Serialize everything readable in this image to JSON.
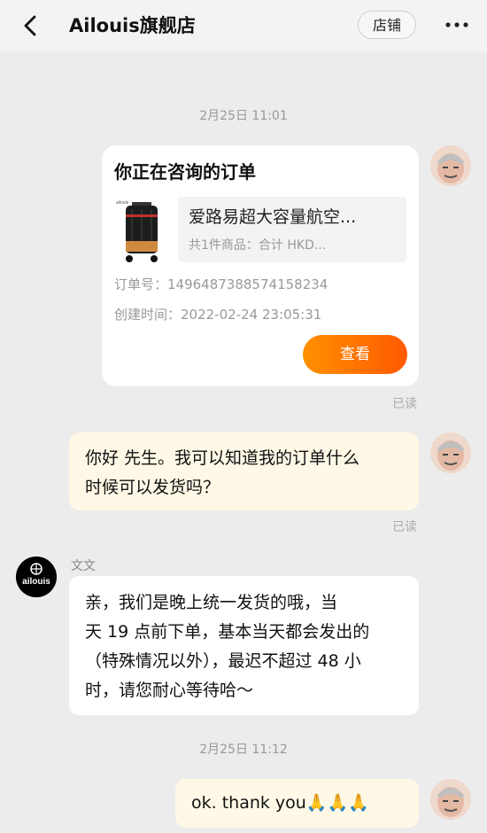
{
  "header": {
    "title": "Ailouis旗舰店",
    "shop_label": "店铺"
  },
  "messages": {
    "time1": "2月25日 11:01",
    "order_card": {
      "title": "你正在咨询的订单",
      "product_name": "爱路易超大容量航空...",
      "summary": "共1件商品：合计 HKD...",
      "order_no": "订单号：1496487388574158234",
      "created": "创建时间：2022-02-24 23:05:31",
      "view_label": "查看",
      "read": "已读"
    },
    "msg1": {
      "line1": "你好 先生。我可以知道我的订单什么",
      "line2": "时候可以发货吗？",
      "read": "已读"
    },
    "sender_name": "文文",
    "logo_text": "ailouis",
    "reply": {
      "line1": "亲，我们是晚上统一发货的哦，当",
      "line2": "天 19 点前下单，基本当天都会发出的",
      "line3": "（特殊情况以外），最迟不超过 48 小",
      "line4": "时，请您耐心等待哈～"
    },
    "time2": "2月25日 11:12",
    "msg2": {
      "text": "ok. thank you",
      "emoji": "🙏🙏🙏"
    }
  },
  "colors": {
    "accent_start": "#ff9000",
    "accent_end": "#ff5a00",
    "outgoing_bubble": "#fff8e6",
    "background": "#ececec"
  },
  "icons": [
    "back-arrow-icon",
    "more-dots-icon",
    "luggage-product-image",
    "user-avatar",
    "ailouis-logo-avatar"
  ]
}
